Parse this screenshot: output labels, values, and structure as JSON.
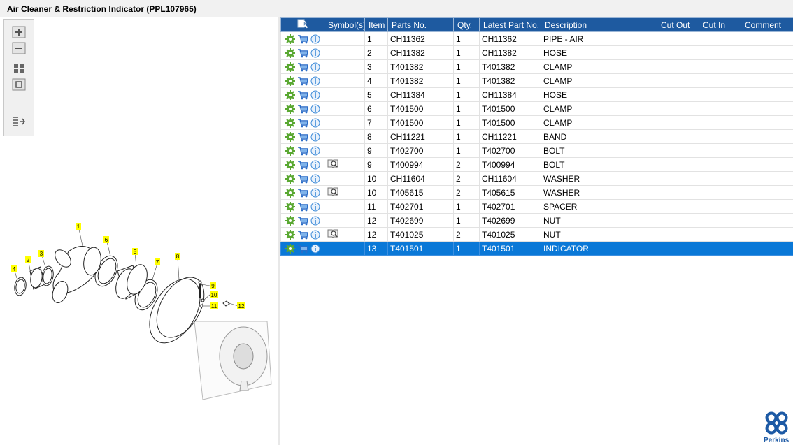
{
  "window": {
    "title": "Air Cleaner & Restriction Indicator (PPL107965)"
  },
  "toolbox": {
    "tools": [
      {
        "name": "zoom-in-icon"
      },
      {
        "name": "zoom-out-icon"
      },
      {
        "name": "fit-grid-icon"
      },
      {
        "name": "fit-window-icon"
      },
      {
        "name": "export-list-icon"
      }
    ]
  },
  "diagram": {
    "callouts": [
      "1",
      "2",
      "3",
      "4",
      "5",
      "6",
      "7",
      "8",
      "9",
      "10",
      "11",
      "12"
    ]
  },
  "table": {
    "columns": [
      "",
      "Symbol(s)",
      "Item",
      "Parts No.",
      "Qty.",
      "Latest Part No.",
      "Description",
      "Cut Out",
      "Cut In",
      "Comment"
    ],
    "rows": [
      {
        "symbol": false,
        "item": "1",
        "part": "CH11362",
        "qty": "1",
        "latest": "CH11362",
        "desc": "PIPE - AIR",
        "cutout": "",
        "cutin": "",
        "comment": ""
      },
      {
        "symbol": false,
        "item": "2",
        "part": "CH11382",
        "qty": "1",
        "latest": "CH11382",
        "desc": "HOSE",
        "cutout": "",
        "cutin": "",
        "comment": ""
      },
      {
        "symbol": false,
        "item": "3",
        "part": "T401382",
        "qty": "1",
        "latest": "T401382",
        "desc": "CLAMP",
        "cutout": "",
        "cutin": "",
        "comment": ""
      },
      {
        "symbol": false,
        "item": "4",
        "part": "T401382",
        "qty": "1",
        "latest": "T401382",
        "desc": "CLAMP",
        "cutout": "",
        "cutin": "",
        "comment": ""
      },
      {
        "symbol": false,
        "item": "5",
        "part": "CH11384",
        "qty": "1",
        "latest": "CH11384",
        "desc": "HOSE",
        "cutout": "",
        "cutin": "",
        "comment": ""
      },
      {
        "symbol": false,
        "item": "6",
        "part": "T401500",
        "qty": "1",
        "latest": "T401500",
        "desc": "CLAMP",
        "cutout": "",
        "cutin": "",
        "comment": ""
      },
      {
        "symbol": false,
        "item": "7",
        "part": "T401500",
        "qty": "1",
        "latest": "T401500",
        "desc": "CLAMP",
        "cutout": "",
        "cutin": "",
        "comment": ""
      },
      {
        "symbol": false,
        "item": "8",
        "part": "CH11221",
        "qty": "1",
        "latest": "CH11221",
        "desc": "BAND",
        "cutout": "",
        "cutin": "",
        "comment": ""
      },
      {
        "symbol": false,
        "item": "9",
        "part": "T402700",
        "qty": "1",
        "latest": "T402700",
        "desc": "BOLT",
        "cutout": "",
        "cutin": "",
        "comment": ""
      },
      {
        "symbol": true,
        "item": "9",
        "part": "T400994",
        "qty": "2",
        "latest": "T400994",
        "desc": "BOLT",
        "cutout": "",
        "cutin": "",
        "comment": ""
      },
      {
        "symbol": false,
        "item": "10",
        "part": "CH11604",
        "qty": "2",
        "latest": "CH11604",
        "desc": "WASHER",
        "cutout": "",
        "cutin": "",
        "comment": ""
      },
      {
        "symbol": true,
        "item": "10",
        "part": "T405615",
        "qty": "2",
        "latest": "T405615",
        "desc": "WASHER",
        "cutout": "",
        "cutin": "",
        "comment": ""
      },
      {
        "symbol": false,
        "item": "11",
        "part": "T402701",
        "qty": "1",
        "latest": "T402701",
        "desc": "SPACER",
        "cutout": "",
        "cutin": "",
        "comment": ""
      },
      {
        "symbol": false,
        "item": "12",
        "part": "T402699",
        "qty": "1",
        "latest": "T402699",
        "desc": "NUT",
        "cutout": "",
        "cutin": "",
        "comment": ""
      },
      {
        "symbol": true,
        "item": "12",
        "part": "T401025",
        "qty": "2",
        "latest": "T401025",
        "desc": "NUT",
        "cutout": "",
        "cutin": "",
        "comment": ""
      },
      {
        "symbol": false,
        "item": "13",
        "part": "T401501",
        "qty": "1",
        "latest": "T401501",
        "desc": "INDICATOR",
        "cutout": "",
        "cutin": "",
        "comment": "",
        "selected": true
      }
    ]
  },
  "logo": {
    "text": "Perkins",
    "color": "#1d5aa5"
  },
  "colors": {
    "header": "#1e5aa0",
    "selection": "#0a78d7",
    "gear": "#5aa832",
    "info": "#3b8ad8"
  }
}
